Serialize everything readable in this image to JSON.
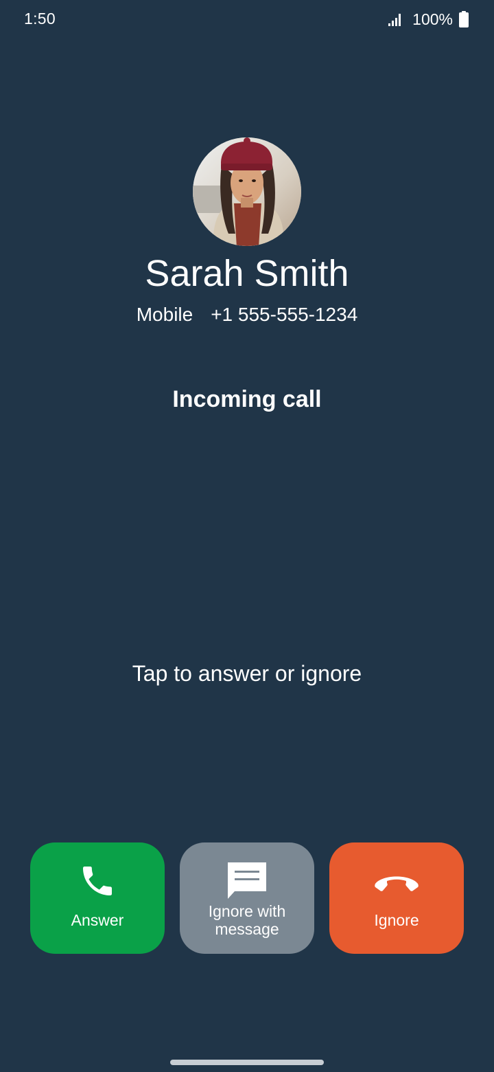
{
  "status_bar": {
    "time": "1:50",
    "battery": "100%",
    "icons": [
      "signal-icon",
      "battery-icon"
    ]
  },
  "caller": {
    "name": "Sarah Smith",
    "number_type": "Mobile",
    "number": "+1 555-555-1234"
  },
  "call_status": "Incoming call",
  "hint": "Tap to answer or ignore",
  "actions": {
    "answer": {
      "label": "Answer",
      "icon": "phone-icon",
      "color": "#0aa148"
    },
    "message": {
      "label": "Ignore with message",
      "icon": "message-icon",
      "color": "#7b8893"
    },
    "ignore": {
      "label": "Ignore",
      "icon": "hang-up-icon",
      "color": "#e75b2f"
    }
  },
  "colors": {
    "background": "#203548",
    "text": "#ffffff"
  }
}
